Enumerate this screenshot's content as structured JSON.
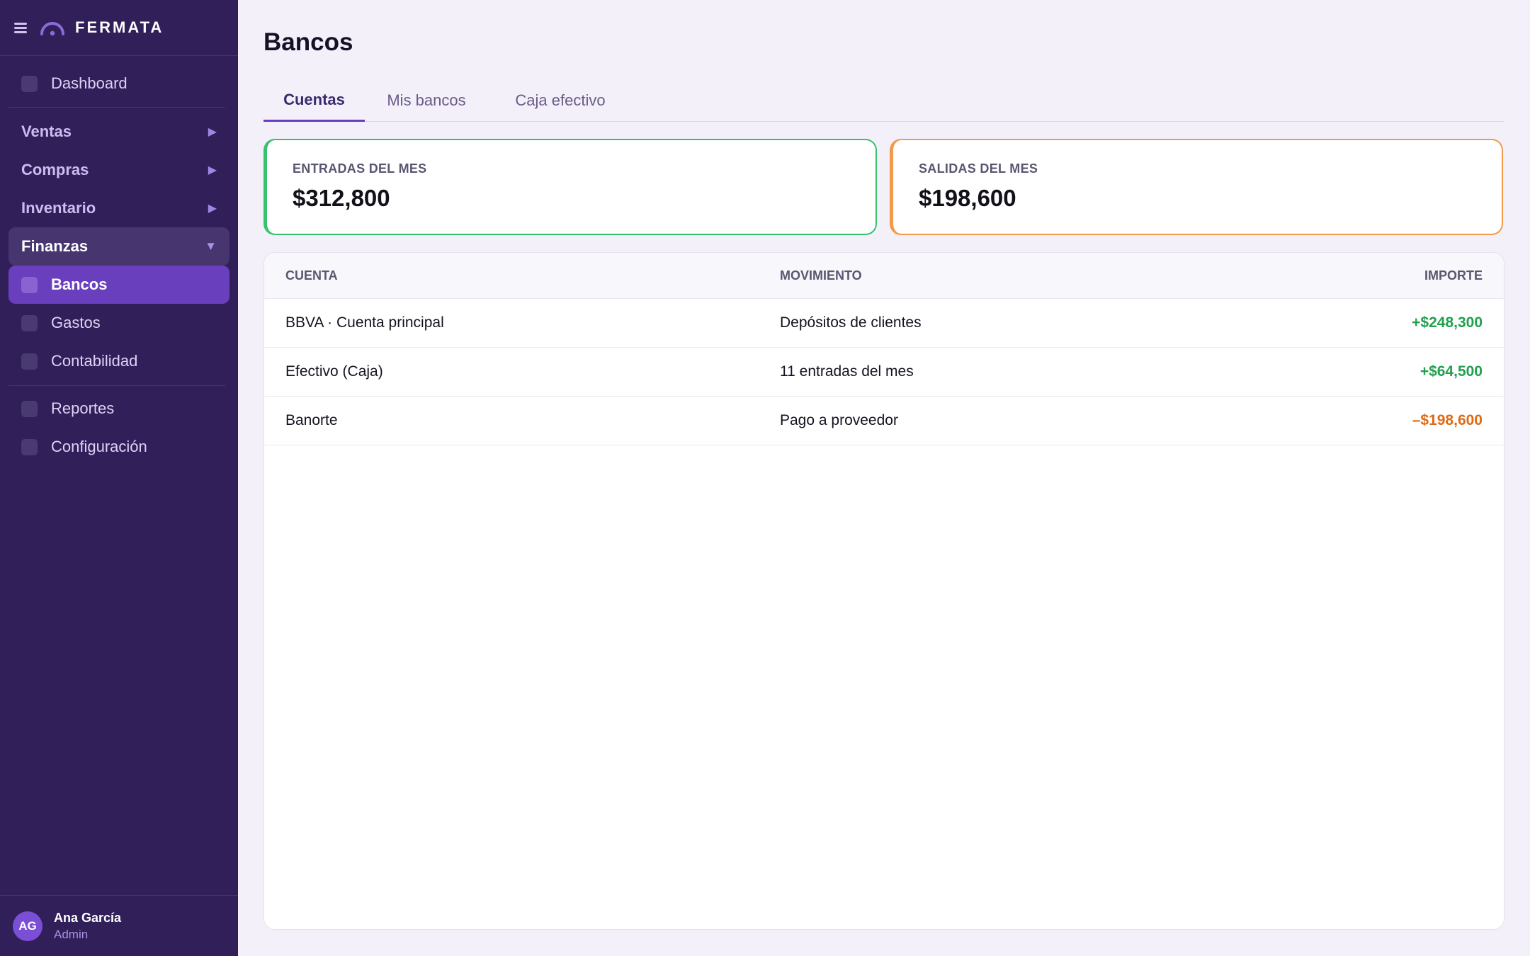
{
  "brand": {
    "name": "FERMATA"
  },
  "sidebar": {
    "dashboard": "Dashboard",
    "groups": [
      {
        "label": "Ventas",
        "arrow": "▶"
      },
      {
        "label": "Compras",
        "arrow": "▶"
      },
      {
        "label": "Inventario",
        "arrow": "▶"
      },
      {
        "label": "Finanzas",
        "arrow": "▼"
      }
    ],
    "finanzas_items": [
      "Bancos",
      "Gastos",
      "Contabilidad"
    ],
    "bottom_items": [
      "Reportes",
      "Configuración"
    ]
  },
  "user": {
    "initials": "AG",
    "name": "Ana García",
    "role": "Admin"
  },
  "page": {
    "title": "Bancos"
  },
  "tabs": [
    "Cuentas",
    "Mis bancos",
    "Caja efectivo"
  ],
  "stats": {
    "in": {
      "label": "ENTRADAS DEL MES",
      "value": "$312,800"
    },
    "out": {
      "label": "SALIDAS DEL MES",
      "value": "$198,600"
    }
  },
  "table": {
    "headers": [
      "CUENTA",
      "MOVIMIENTO",
      "IMPORTE"
    ],
    "rows": [
      {
        "cuenta": "BBVA · Cuenta principal",
        "movimiento": "Depósitos de clientes",
        "importe": "+$248,300"
      },
      {
        "cuenta": "Efectivo (Caja)",
        "movimiento": "11 entradas del mes",
        "importe": "+$64,500"
      },
      {
        "cuenta": "Banorte",
        "movimiento": "Pago a proveedor",
        "importe": "–$198,600"
      }
    ]
  },
  "colors": {
    "accent": "#6a3fbd",
    "sidebar": "#311f5a",
    "positive": "#22a04e",
    "negative": "#df6a13",
    "in_border": "#37c26e",
    "out_border": "#f39a48"
  }
}
